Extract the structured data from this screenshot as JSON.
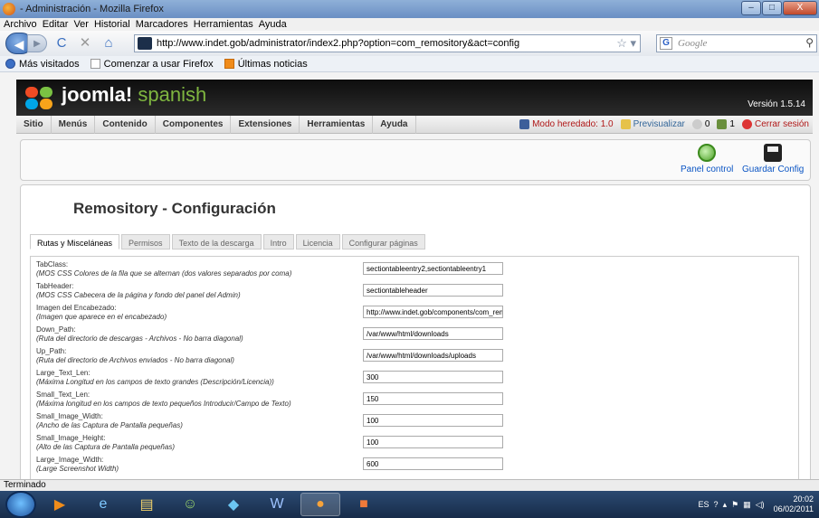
{
  "window": {
    "title": "- Administración - Mozilla Firefox",
    "buttons": [
      "–",
      "□",
      "X"
    ]
  },
  "menubar": [
    "Archivo",
    "Editar",
    "Ver",
    "Historial",
    "Marcadores",
    "Herramientas",
    "Ayuda"
  ],
  "nav": {
    "url": "http://www.indet.gob/administrator/index2.php?option=com_remository&act=config",
    "search_placeholder": "Google"
  },
  "bookmarks": [
    "Más visitados",
    "Comenzar a usar Firefox",
    "Últimas noticias"
  ],
  "joomla": {
    "brand": "joomla!",
    "brand_suffix": "spanish",
    "version": "Versión 1.5.14",
    "menu": [
      "Sitio",
      "Menús",
      "Contenido",
      "Componentes",
      "Extensiones",
      "Herramientas",
      "Ayuda"
    ],
    "status": {
      "legacy": "Modo heredado: 1.0",
      "preview": "Previsualizar",
      "messages": "0",
      "users": "1",
      "logout": "Cerrar sesión"
    },
    "toolbar": {
      "panel": "Panel control",
      "save": "Guardar Config"
    }
  },
  "page": {
    "title": "Remository - Configuración",
    "tabs": [
      "Rutas y Misceláneas",
      "Permisos",
      "Texto de la descarga",
      "Intro",
      "Licencia",
      "Configurar páginas"
    ],
    "fields": [
      {
        "label": "TabClass:",
        "desc": "(MOS CSS Colores de la fila que se alternan (dos valores separados por coma)",
        "value": "sectiontableentry2,sectiontableentry1"
      },
      {
        "label": "TabHeader:",
        "desc": "(MOS CSS Cabecera de la página y fondo del panel del Admin)",
        "value": "sectiontableheader"
      },
      {
        "label": "Imagen del Encabezado:",
        "desc": "(Imagen que aparece en el encabezado)",
        "value": "http://www.indet.gob/components/com_remosi"
      },
      {
        "label": "Down_Path:",
        "desc": "(Ruta del directorio de descargas - Archivos - No barra diagonal)",
        "value": "/var/www/html/downloads"
      },
      {
        "label": "Up_Path:",
        "desc": "(Ruta del directorio de Archivos enviados - No barra diagonal)",
        "value": "/var/www/html/downloads/uploads"
      },
      {
        "label": "Large_Text_Len:",
        "desc": "(Máxima Longitud en los campos de texto grandes (Descripción/Licencia))",
        "value": "300"
      },
      {
        "label": "Small_Text_Len:",
        "desc": "(Máxima longitud en los campos de texto pequeños Introducir/Campo de Texto)",
        "value": "150"
      },
      {
        "label": "Small_Image_Width:",
        "desc": "(Ancho de las Captura de Pantalla pequeñas)",
        "value": "100"
      },
      {
        "label": "Small_Image_Height:",
        "desc": "(Alto de las Captura de Pantalla pequeñas)",
        "value": "100"
      },
      {
        "label": "Large_Image_Width:",
        "desc": "(Large Screenshot Width)",
        "value": "600"
      }
    ]
  },
  "statusbar": "Terminado",
  "taskbar": {
    "lang": "ES",
    "time": "20:02",
    "date": "06/02/2011"
  }
}
